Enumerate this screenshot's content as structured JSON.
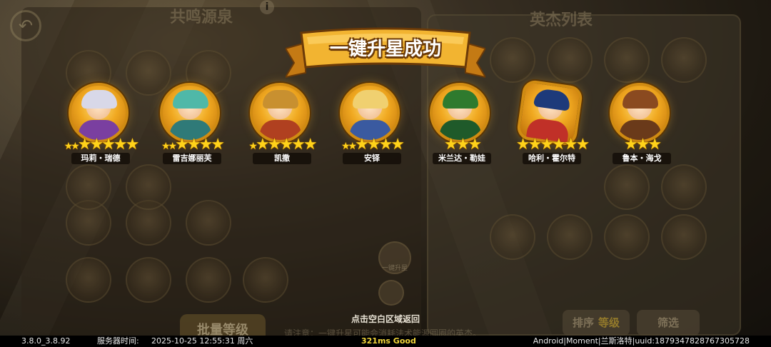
{
  "popup": {
    "title": "一键升星成功",
    "tap_to_return": "点击空白区域返回"
  },
  "heroes": [
    {
      "name": "玛莉・瑞德",
      "stars": 5,
      "small_stars": 2,
      "portrait": "hero-mary-read",
      "hair": "#d8d8e8",
      "outfit": "#7a3fa0"
    },
    {
      "name": "雷吉娜丽芙",
      "stars": 4,
      "small_stars": 2,
      "portrait": "hero-regina-lief",
      "hair": "#4fb8a8",
      "outfit": "#2f7a78"
    },
    {
      "name": "凯撒",
      "stars": 5,
      "small_stars": 1,
      "portrait": "hero-caesar",
      "hair": "#c89030",
      "outfit": "#b04020"
    },
    {
      "name": "安铎",
      "stars": 4,
      "small_stars": 2,
      "portrait": "hero-ando",
      "hair": "#f0d070",
      "outfit": "#3a5aa0"
    },
    {
      "name": "米兰达・勒娃",
      "stars": 3,
      "small_stars": 0,
      "portrait": "hero-miranda-leva",
      "hair": "#2e7a2e",
      "outfit": "#1f5a2a"
    },
    {
      "name": "哈利・霍尔特",
      "stars": 6,
      "small_stars": 0,
      "portrait": "hero-harry-holt",
      "hair": "#1d3a7a",
      "outfit": "#c03028"
    },
    {
      "name": "鲁本・海戈",
      "stars": 3,
      "small_stars": 0,
      "portrait": "hero-ruben-haigo",
      "hair": "#8a4a20",
      "outfit": "#6a3a1a"
    }
  ],
  "background": {
    "left_title": "共鸣源泉",
    "right_title": "英杰列表",
    "sort_label": "排序",
    "sort_value": "等级",
    "filter_label": "筛选",
    "batch_label": "批量等级",
    "one_key_label": "一键升星",
    "hint_text": "请注意：一键升星可能会消耗法术能源圆圈的英杰。"
  },
  "statusbar": {
    "version": "3.8.0_3.8.92",
    "server_time_label": "服务器时间:",
    "server_time": "2025-10-25  12:55:31  周六",
    "ping": "321ms Good",
    "device_info": "Android|Moment|兰斯洛特|uuid:1879347828767305728"
  },
  "colors": {
    "star": "#ffd21a",
    "banner": "#f2b431",
    "banner_edge": "#8a4c0c",
    "ping": "#f0d43a"
  }
}
